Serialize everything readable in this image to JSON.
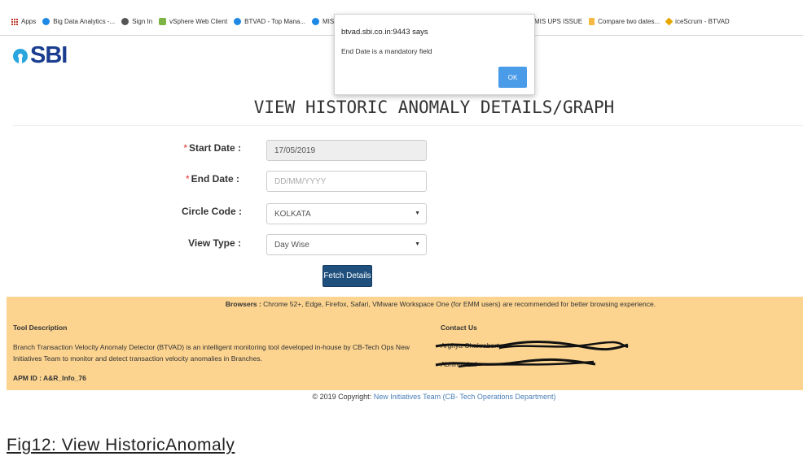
{
  "bookmarks": {
    "items": [
      {
        "label": "Apps",
        "icon": "apps-grid-icon"
      },
      {
        "label": "Big Data Analytics -...",
        "icon": "site-icon",
        "color": "#1e88e5"
      },
      {
        "label": "Sign In",
        "icon": "globe-icon",
        "color": "#555555"
      },
      {
        "label": "vSphere Web Client",
        "icon": "vsphere-icon",
        "color": "#7cb342"
      },
      {
        "label": "BTVAD - Top Mana...",
        "icon": "site-icon",
        "color": "#1e88e5"
      },
      {
        "label": "MIS_Anomalies_V_...",
        "icon": "site-icon",
        "color": "#1e88e5"
      }
    ],
    "right_items": [
      {
        "label": "MIS UPS ISSUE",
        "icon": "none"
      },
      {
        "label": "Compare two dates...",
        "icon": "doc-icon",
        "color": "#f5b942"
      },
      {
        "label": "iceScrum - BTVAD",
        "icon": "icescrum-icon",
        "color": "#e6a800"
      }
    ]
  },
  "logo": {
    "text": "SBI",
    "color": "#1a3d8f",
    "circle_color": "#2aa5de"
  },
  "page": {
    "title": "VIEW HISTORIC ANOMALY DETAILS/GRAPH"
  },
  "form": {
    "start_date": {
      "label": "Start Date :",
      "required_mark": "*",
      "value": "17/05/2019"
    },
    "end_date": {
      "label": "End Date :",
      "required_mark": "*",
      "placeholder": "DD/MM/YYYY"
    },
    "circle_code": {
      "label": "Circle Code :",
      "value": "KOLKATA"
    },
    "view_type": {
      "label": "View Type :",
      "value": "Day Wise"
    },
    "fetch_label": "Fetch Details"
  },
  "info": {
    "browsers_label": "Browsers :",
    "browsers_text": "Chrome 52+, Edge, Firefox, Safari, VMware Workspace One (for EMM users) are recommended for better browsing experience.",
    "tool_heading": "Tool Description",
    "tool_text": "Branch Transaction Velocity Anomaly Detector (BTVAD) is an intelligent monitoring tool developed in-house by CB-Tech Ops New Initiatives Team to monitor and detect transaction velocity anomalies in Branches.",
    "apm_id": "APM ID : A&R_Info_76",
    "contact_heading": "Contact Us",
    "contact_1": "Arghya Chakraborty",
    "contact_2": "Abhinav Lal",
    "background": "#fcd490"
  },
  "copyright": {
    "prefix": "© 2019 Copyright:",
    "link": "New Initiatives Team (CB- Tech Operations Department)"
  },
  "caption": "Fig12: View HistoricAnomaly",
  "alert": {
    "origin": "btvad.sbi.co.in:9443 says",
    "message": "End Date is a mandatory field",
    "ok_label": "OK"
  }
}
